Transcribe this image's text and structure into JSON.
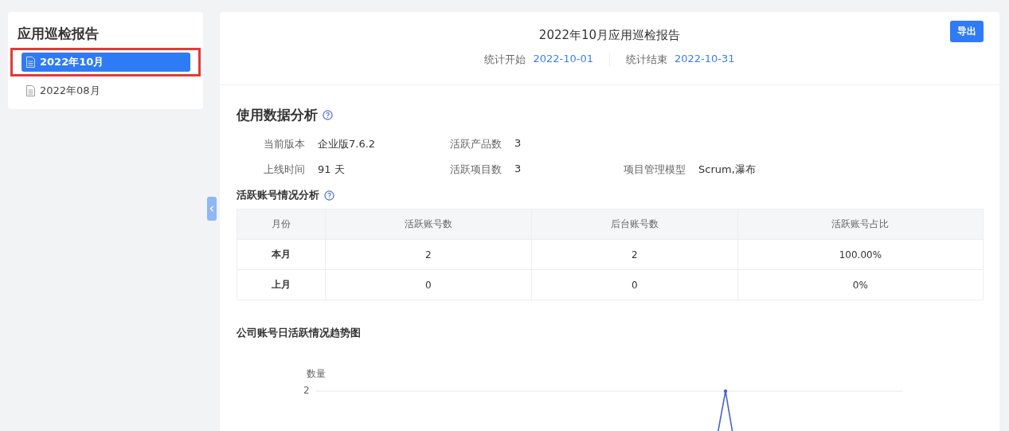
{
  "sidebar": {
    "title": "应用巡检报告",
    "items": [
      {
        "label": "2022年10月",
        "selected": true,
        "highlighted": true
      },
      {
        "label": "2022年08月",
        "selected": false,
        "highlighted": false
      }
    ]
  },
  "report": {
    "title": "2022年10月应用巡检报告",
    "export_button": "导出",
    "period": [
      {
        "label": "统计开始",
        "value": "2022-10-01"
      },
      {
        "label": "统计结束",
        "value": "2022-10-31"
      }
    ]
  },
  "usage": {
    "title": "使用数据分析",
    "fields": [
      {
        "label": "当前版本",
        "value": "企业版7.6.2"
      },
      {
        "label": "活跃产品数",
        "value": "3"
      },
      {
        "label": "上线时间",
        "value": "91 天"
      },
      {
        "label": "活跃项目数",
        "value": "3"
      },
      {
        "label": "项目管理模型",
        "value": "Scrum,瀑布"
      }
    ]
  },
  "accounts": {
    "title": "活跃账号情况分析",
    "columns": [
      "月份",
      "活跃账号数",
      "后台账号数",
      "活跃账号占比"
    ],
    "rows": [
      [
        "本月",
        "2",
        "2",
        "100.00%"
      ],
      [
        "上月",
        "0",
        "0",
        "0%"
      ]
    ]
  },
  "trend": {
    "title": "公司账号日活跃情况趋势图",
    "ylabel": "数量",
    "ytick": "2"
  }
}
